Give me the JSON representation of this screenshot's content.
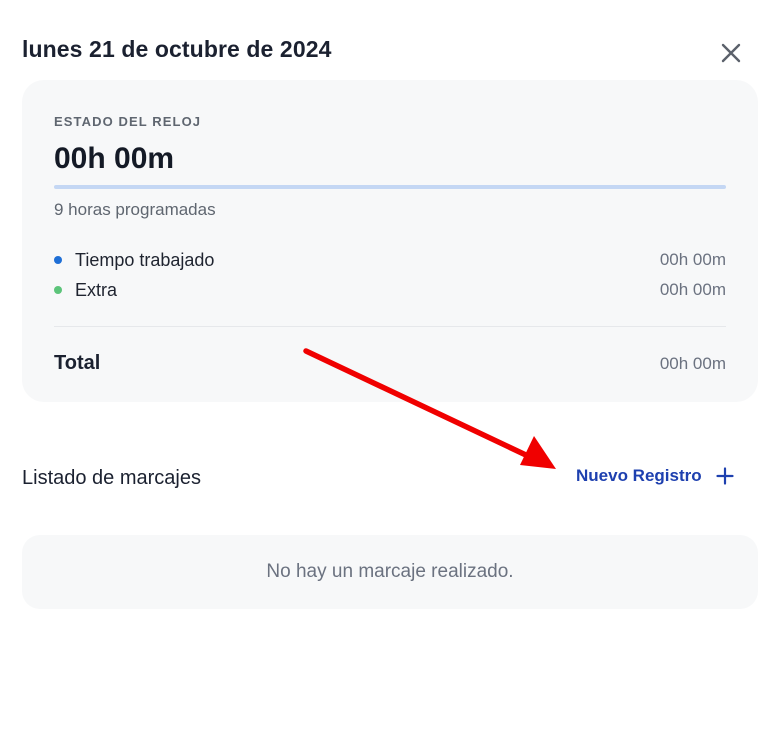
{
  "header": {
    "title": "lunes 21 de octubre de 2024",
    "close_icon": "close-icon"
  },
  "clock": {
    "label": "ESTADO DEL RELOJ",
    "time": "00h 00m",
    "progress_percent": 0,
    "scheduled": "9 horas programadas",
    "rows": [
      {
        "label": "Tiempo trabajado",
        "value": "00h 00m",
        "dot_color": "#1f6fd6"
      },
      {
        "label": "Extra",
        "value": "00h 00m",
        "dot_color": "#5cc47a"
      }
    ],
    "total_label": "Total",
    "total_value": "00h 00m"
  },
  "marks": {
    "title": "Listado de marcajes",
    "new_record_label": "Nuevo Registro",
    "new_record_icon": "plus-icon",
    "empty_message": "No hay un marcaje realizado."
  },
  "colors": {
    "accent": "#1e40af",
    "annotation": "#f00000",
    "progress_track": "#c4d7f4"
  }
}
